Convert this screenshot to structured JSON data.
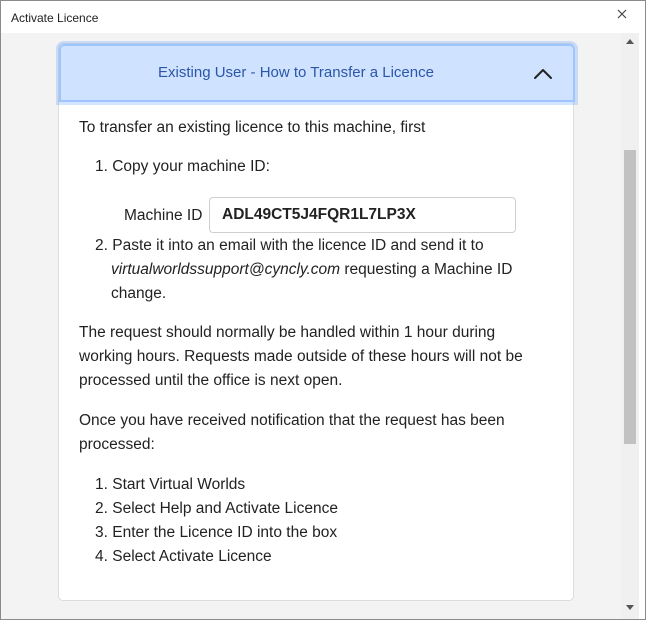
{
  "window": {
    "title": "Activate Licence"
  },
  "icons": {
    "close": "close-icon",
    "chevron_up": "chevron-up-icon",
    "scroll_up": "scroll-up-icon",
    "scroll_down": "scroll-down-icon"
  },
  "accordion": {
    "header": "Existing User - How to Transfer a Licence",
    "intro": "To transfer an existing licence to this machine, first",
    "step1": "1. Copy your machine ID:",
    "machine_id_label": "Machine ID",
    "machine_id_value": "ADL49CT5J4FQR1L7LP3X",
    "step2_line1": "2. Paste it into an email with the licence ID and send it to",
    "step2_email": "virtualworldssupport@cyncly.com",
    "step2_rest": " requesting a Machine ID",
    "step2_line3": "change.",
    "request_line1": "The request should normally be handled within 1 hour during",
    "request_line2": "working hours. Requests made outside of these hours will not be",
    "request_line3": "processed until the office is next open.",
    "notify_line1": "Once you have received notification that the request has been",
    "notify_line2": "processed:",
    "final_steps": [
      "1. Start Virtual Worlds",
      "2. Select Help and Activate Licence",
      "3. Enter the Licence ID into the box",
      "4. Select Activate Licence"
    ]
  }
}
